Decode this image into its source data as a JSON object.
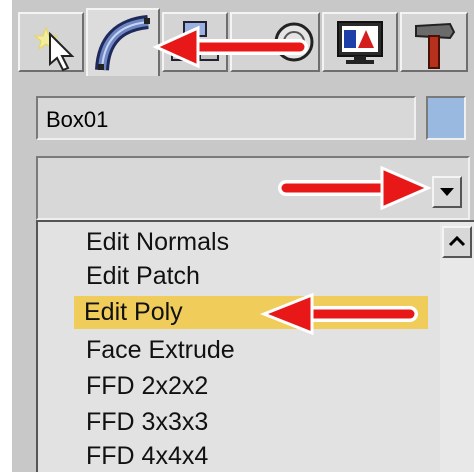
{
  "command_panel": {
    "tabs": [
      {
        "name": "create",
        "icon": "create-cursor-icon"
      },
      {
        "name": "modify",
        "icon": "modify-curve-icon",
        "active": true
      },
      {
        "name": "hierarchy",
        "icon": "hierarchy-icon"
      },
      {
        "name": "motion",
        "icon": "motion-icon"
      },
      {
        "name": "display",
        "icon": "display-monitor-icon"
      },
      {
        "name": "utilities",
        "icon": "hammer-icon"
      }
    ]
  },
  "object": {
    "name": "Box01",
    "color": "#9ab9e1"
  },
  "modifier_dropdown": {
    "value": ""
  },
  "modifier_list": {
    "items": [
      "Edit Normals",
      "Edit Patch",
      "Edit Poly",
      "Face Extrude",
      "FFD 2x2x2",
      "FFD 3x3x3",
      "FFD 4x4x4"
    ],
    "selected": "Edit Poly"
  },
  "annotation_color": "#e81818"
}
